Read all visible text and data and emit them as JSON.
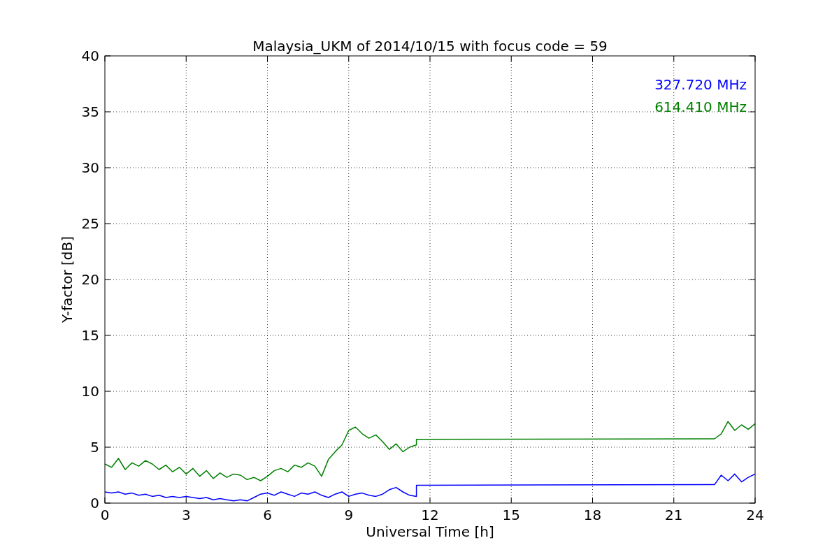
{
  "chart": {
    "chart_data": {
      "type": "line",
      "title": "Malaysia_UKM of 2014/10/15 with focus code = 59",
      "xlabel": "Universal Time [h]",
      "ylabel": "Y-factor [dB]",
      "x": [
        0,
        0.25,
        0.5,
        0.75,
        1,
        1.25,
        1.5,
        1.75,
        2,
        2.25,
        2.5,
        2.75,
        3,
        3.25,
        3.5,
        3.75,
        4,
        4.25,
        4.5,
        4.75,
        5,
        5.25,
        5.5,
        5.75,
        6,
        6.25,
        6.5,
        6.75,
        7,
        7.25,
        7.5,
        7.75,
        8,
        8.25,
        8.5,
        8.75,
        9,
        9.25,
        9.5,
        9.75,
        10,
        10.25,
        10.5,
        10.75,
        11,
        11.25,
        11.5,
        11.5,
        22.5,
        22.75,
        23,
        23.25,
        23.5,
        23.75,
        24
      ],
      "series": [
        {
          "name": "327.720 MHz",
          "color": "#0000ff",
          "values": [
            1.0,
            0.9,
            1.0,
            0.8,
            0.9,
            0.7,
            0.8,
            0.6,
            0.7,
            0.5,
            0.6,
            0.5,
            0.6,
            0.5,
            0.4,
            0.5,
            0.3,
            0.4,
            0.3,
            0.2,
            0.3,
            0.2,
            0.5,
            0.8,
            0.9,
            0.7,
            1.0,
            0.8,
            0.6,
            0.9,
            0.8,
            1.0,
            0.7,
            0.5,
            0.8,
            1.0,
            0.6,
            0.8,
            0.9,
            0.7,
            0.6,
            0.8,
            1.2,
            1.4,
            1.0,
            0.7,
            0.6,
            1.6,
            1.65,
            2.5,
            2.0,
            2.6,
            1.9,
            2.3,
            2.6
          ]
        },
        {
          "name": "614.410 MHz",
          "color": "#008000",
          "values": [
            3.5,
            3.2,
            4.0,
            3.0,
            3.6,
            3.3,
            3.8,
            3.5,
            3.0,
            3.4,
            2.8,
            3.2,
            2.6,
            3.1,
            2.4,
            2.9,
            2.2,
            2.7,
            2.3,
            2.6,
            2.5,
            2.1,
            2.3,
            2.0,
            2.4,
            2.9,
            3.1,
            2.8,
            3.4,
            3.2,
            3.6,
            3.3,
            2.4,
            3.9,
            4.6,
            5.2,
            6.5,
            6.8,
            6.2,
            5.8,
            6.1,
            5.5,
            4.8,
            5.3,
            4.6,
            5.0,
            5.2,
            5.7,
            5.75,
            6.2,
            7.3,
            6.5,
            7.0,
            6.6,
            7.1
          ]
        }
      ],
      "grid": true,
      "xlim": [
        0,
        24
      ],
      "ylim": [
        0,
        40
      ],
      "xticks": [
        0,
        3,
        6,
        9,
        12,
        15,
        18,
        21,
        24
      ],
      "yticks": [
        0,
        5,
        10,
        15,
        20,
        25,
        30,
        35,
        40
      ]
    }
  }
}
